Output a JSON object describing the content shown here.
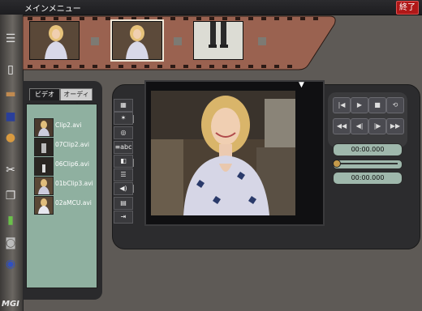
{
  "window": {
    "title": "メインメニュー",
    "close_label": "終了"
  },
  "sidebar": {
    "icons": [
      "menu-icon",
      "new-file-icon",
      "open-folder-icon",
      "save-disk-icon",
      "paint-icon",
      "scissors-icon",
      "copy-icon",
      "battery-icon",
      "camera-icon",
      "capture-icon"
    ],
    "brand": "MGI"
  },
  "filmstrip": {
    "thumbnails": 3,
    "selected_index": 1
  },
  "bin": {
    "tabs": [
      "ビデオ",
      "オーディオ"
    ],
    "active_tab": 0,
    "clips": [
      "Clip2.avi",
      "07Clip2.avi",
      "06Clip6.avi",
      "01bClip3.avi",
      "02aMCU.avi"
    ]
  },
  "tools": [
    {
      "name": "video-overlay-tool-icon",
      "glyph": "▦"
    },
    {
      "name": "transition-tool-icon",
      "glyph": "✶"
    },
    {
      "name": "effect-tool-icon",
      "glyph": "◎"
    },
    {
      "name": "text-tool-icon",
      "glyph": "≡abc"
    },
    {
      "name": "clip-tool-icon",
      "glyph": "◧"
    },
    {
      "name": "storyboard-tool-icon",
      "glyph": "☰"
    },
    {
      "name": "audio-tool-icon",
      "glyph": "◀)"
    },
    {
      "name": "scene-tool-icon",
      "glyph": "▤"
    },
    {
      "name": "output-tool-icon",
      "glyph": "⇥"
    }
  ],
  "playback": {
    "buttons": [
      "|◀",
      "▶",
      "■",
      "⟲",
      "◀◀",
      "◀|",
      "|▶",
      "▶▶"
    ],
    "time_start": "00:00.000",
    "time_end": "00:00.000",
    "position": 0
  },
  "colors": {
    "accent": "#b01818",
    "bin_bg": "#8fb0a0",
    "panel": "#2c2c2e",
    "film": "#a86a58"
  }
}
